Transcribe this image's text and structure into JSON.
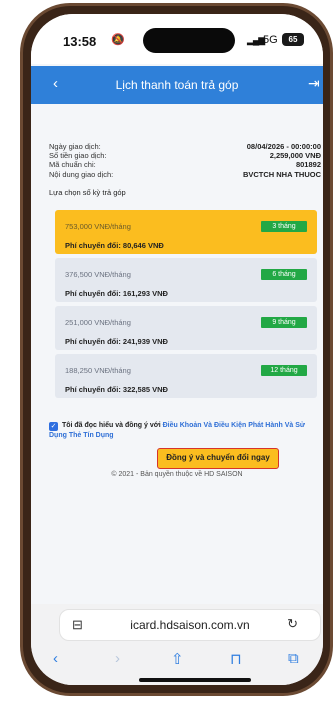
{
  "status_bar": {
    "time": "13:58",
    "time_icon": "focus-bell-icon",
    "signal_icon": "cell-signal-icon",
    "network": "5G",
    "battery": "65"
  },
  "header": {
    "title": "Lịch thanh toán trả góp",
    "back_icon": "chevron-left-icon",
    "logout_icon": "logout-icon",
    "color": "#2f80d9"
  },
  "transaction": {
    "rows": [
      {
        "label": "Ngày giao dịch:",
        "value": "08/04/2026 - 00:00:00"
      },
      {
        "label": "Số tiền giao dịch:",
        "value": "2,259,000 VNĐ"
      },
      {
        "label": "Mã chuẩn chi:",
        "value": "801892"
      },
      {
        "label": "Nội dung giao dịch:",
        "value": "BVCTCH NHA THUOC"
      }
    ],
    "choose_label": "Lựa chọn số kỳ trả góp"
  },
  "plans": [
    {
      "amount": "753,000 VNĐ/tháng",
      "term": "3 tháng",
      "fee": "Phí chuyển đổi: 80,646 VNĐ",
      "selected": true
    },
    {
      "amount": "376,500 VNĐ/tháng",
      "term": "6 tháng",
      "fee": "Phí chuyển đổi: 161,293 VNĐ",
      "selected": false
    },
    {
      "amount": "251,000 VNĐ/tháng",
      "term": "9 tháng",
      "fee": "Phí chuyển đổi: 241,939 VNĐ",
      "selected": false
    },
    {
      "amount": "188,250 VNĐ/tháng",
      "term": "12 tháng",
      "fee": "Phí chuyển đổi: 322,585 VNĐ",
      "selected": false
    }
  ],
  "agreement": {
    "checked": true,
    "text": "Tôi đã đọc hiểu và đồng ý với",
    "link": "Điều Khoản Và Điều Kiện Phát Hành Và Sử Dụng Thẻ Tín Dụng"
  },
  "submit_label": "Đồng ý và chuyển đổi ngay",
  "copyright": "© 2021 - Bản quyền thuộc về HD SAISON",
  "browser": {
    "url": "icard.hdsaison.com.vn",
    "page_icon": "page-format-icon",
    "reload_icon": "reload-icon",
    "toolbar": [
      "back-icon",
      "forward-icon",
      "share-icon",
      "bookmarks-icon",
      "tabs-icon"
    ]
  },
  "colors": {
    "accent": "#2f80d9",
    "selected_plan": "#fbbd1f",
    "badge": "#22a845",
    "link": "#2f6fd6"
  }
}
